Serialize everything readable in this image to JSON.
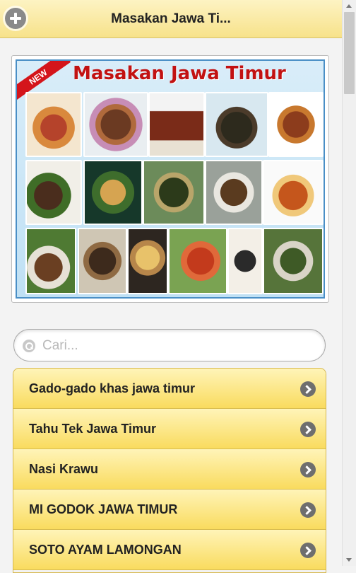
{
  "header": {
    "title": "Masakan Jawa Ti...",
    "add_icon": "plus-circle-icon"
  },
  "banner": {
    "ribbon": "NEW",
    "title": "Masakan Jawa Timur",
    "image_description": "collage of East Javanese dishes"
  },
  "search": {
    "placeholder": "Cari...",
    "value": "",
    "icon": "search-icon"
  },
  "list": {
    "items": [
      {
        "label": "Gado-gado khas jawa timur",
        "icon": "chevron-right-icon"
      },
      {
        "label": "Tahu Tek Jawa Timur",
        "icon": "chevron-right-icon"
      },
      {
        "label": "Nasi Krawu",
        "icon": "chevron-right-icon"
      },
      {
        "label": "MI GODOK JAWA TIMUR",
        "icon": "chevron-right-icon"
      },
      {
        "label": "SOTO AYAM LAMONGAN",
        "icon": "chevron-right-icon"
      }
    ]
  },
  "colors": {
    "header_bg": "#f7e28a",
    "list_item_bg": "#f9db5e",
    "banner_title": "#c21212",
    "banner_border": "#4a8fc6"
  }
}
